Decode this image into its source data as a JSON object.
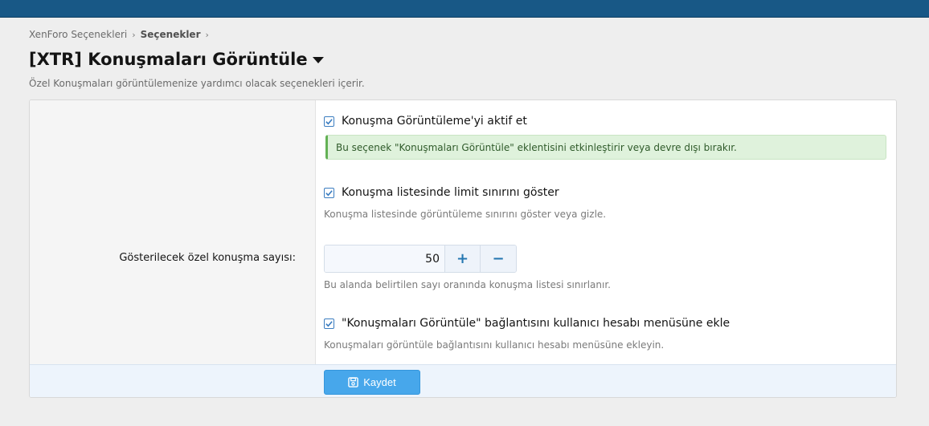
{
  "breadcrumb": {
    "items": [
      "XenForo Seçenekleri",
      "Seçenekler"
    ],
    "separator": "›"
  },
  "page": {
    "title": "[XTR] Konuşmaları Görüntüle",
    "description": "Özel Konuşmaları görüntülemenize yardımcı olacak seçenekleri içerir."
  },
  "options": {
    "enable": {
      "label": "Konuşma Görüntüleme'yi aktif et",
      "checked": true,
      "notice": "Bu seçenek \"Konuşmaları Görüntüle\" eklentisini etkinleştirir veya devre dışı bırakır."
    },
    "show_limit": {
      "label": "Konuşma listesinde limit sınırını göster",
      "checked": true,
      "hint": "Konuşma listesinde görüntüleme sınırını göster veya gizle."
    },
    "count": {
      "label": "Gösterilecek özel konuşma sayısı:",
      "value": "50",
      "plus": "+",
      "minus": "−",
      "hint": "Bu alanda belirtilen sayı oranında konuşma listesi sınırlanır."
    },
    "menu_link": {
      "label": "\"Konuşmaları Görüntüle\" bağlantısını kullanıcı hesabı menüsüne ekle",
      "checked": true,
      "hint": "Konuşmaları görüntüle bağlantısını kullanıcı hesabı menüsüne ekleyin."
    }
  },
  "footer": {
    "save_label": "Kaydet",
    "save_icon": "save-icon"
  },
  "colors": {
    "topbar": "#185886",
    "accent": "#47a7eb",
    "notice_bg": "#dff2dc",
    "notice_border": "#63b155"
  }
}
